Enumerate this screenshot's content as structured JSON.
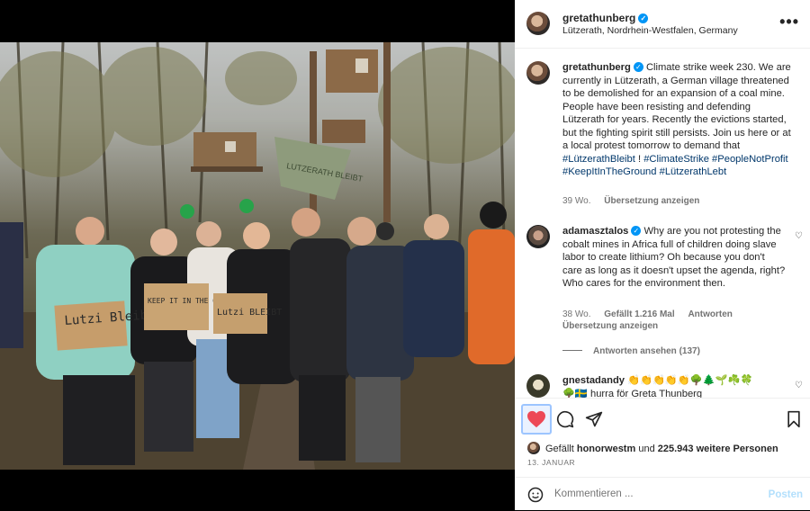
{
  "header": {
    "username": "gretathunberg",
    "location": "Lützerath, Nordrhein-Westfalen, Germany",
    "more": "•••"
  },
  "caption": {
    "username": "gretathunberg",
    "text": "Climate strike week 230. We are currently in Lützerath, a German village threatened to be demolished for an expansion of a coal mine. People have been resisting and defending Lützerath for years. Recently the evictions started, but the fighting spirit still persists. Join us here or at a local protest tomorrow to demand that",
    "tag1": "#LützerathBleibt",
    "after_tag1": " !",
    "tags": "#ClimateStrike #PeopleNotProfit #KeepItInTheGround #LützerathLebt",
    "age": "39 Wo.",
    "translate": "Übersetzung anzeigen"
  },
  "comment1": {
    "username": "adamasztalos",
    "text": "Why are you not protesting the cobalt mines in Africa full of children doing slave labor to create lithium? Oh because you don't care as long as it doesn't upset the agenda, right? Who cares for the environment then.",
    "age": "38 Wo.",
    "likes": "Gefällt 1.216 Mal",
    "reply": "Antworten",
    "translate": "Übersetzung anzeigen",
    "view_replies": "Antworten ansehen (137)"
  },
  "comment2": {
    "username": "gnestadandy",
    "text": "👏👏👏👏👏🌳🌲🌱☘️🍀",
    "text2": "🌳🇸🇪 hurra för Greta Thunberg"
  },
  "photo": {
    "sign1": "Lutzi Bleibt",
    "sign2": "KEEP IT IN THE GROUND",
    "sign3": "Lutzi BLEIBT",
    "banner": "LUTZERATH BLEIBT"
  },
  "likes": {
    "prefix": "Gefällt",
    "user": "honorwestm",
    "middle": "und",
    "count": "225.943 weitere Personen"
  },
  "date": "13. JANUAR",
  "add_comment": {
    "placeholder": "Kommentieren ...",
    "post": "Posten"
  },
  "colors": {
    "like_red": "#ed4956",
    "link_blue": "#00376b",
    "verified_blue": "#0095f6"
  }
}
